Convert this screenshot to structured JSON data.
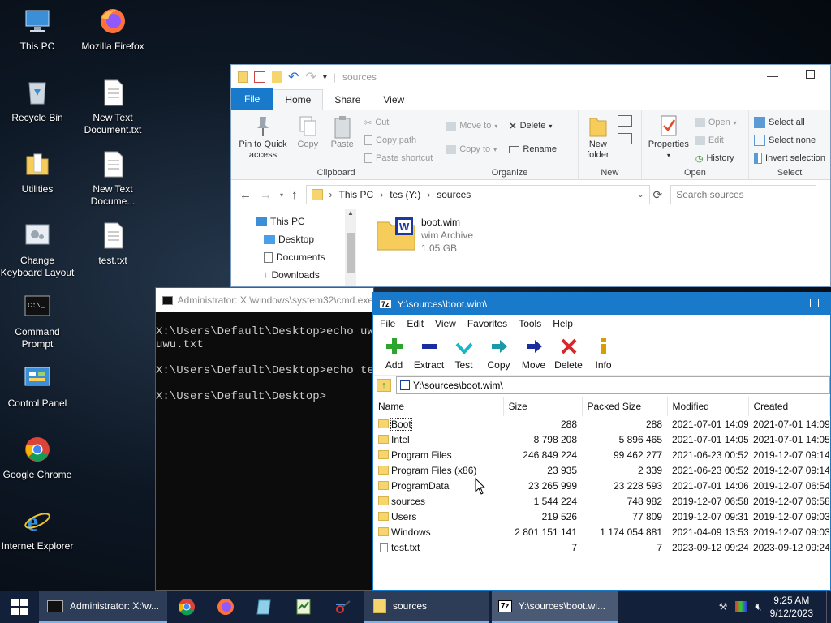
{
  "desktop": {
    "icons": [
      {
        "label": "This PC"
      },
      {
        "label": "Mozilla Firefox"
      },
      {
        "label": "Recycle Bin"
      },
      {
        "label": "New Text Document.txt"
      },
      {
        "label": "Utilities"
      },
      {
        "label": "New Text Docume..."
      },
      {
        "label": "Change Keyboard Layout"
      },
      {
        "label": "test.txt"
      },
      {
        "label": "Command Prompt"
      },
      {
        "label": "Control Panel"
      },
      {
        "label": "Google Chrome"
      },
      {
        "label": "Internet Explorer"
      }
    ]
  },
  "explorer": {
    "title": "sources",
    "tabs": {
      "file": "File",
      "home": "Home",
      "share": "Share",
      "view": "View"
    },
    "clipboard": {
      "pin": "Pin to Quick access",
      "copy": "Copy",
      "paste": "Paste",
      "cut": "Cut",
      "copy_path": "Copy path",
      "paste_shortcut": "Paste shortcut",
      "group": "Clipboard"
    },
    "organize": {
      "move_to": "Move to",
      "copy_to": "Copy to",
      "delete": "Delete",
      "rename": "Rename",
      "group": "Organize"
    },
    "new": {
      "new_folder": "New folder",
      "group": "New"
    },
    "open": {
      "properties": "Properties",
      "open": "Open",
      "edit": "Edit",
      "history": "History",
      "group": "Open"
    },
    "select": {
      "select_all": "Select all",
      "select_none": "Select none",
      "invert": "Invert selection",
      "group": "Select"
    },
    "address": {
      "this_pc": "This PC",
      "drive": "tes (Y:)",
      "folder": "sources"
    },
    "search_placeholder": "Search sources",
    "nav": {
      "this_pc": "This PC",
      "desktop": "Desktop",
      "documents": "Documents",
      "downloads": "Downloads"
    },
    "file": {
      "name": "boot.wim",
      "type": "wim Archive",
      "size": "1.05 GB"
    }
  },
  "cmd": {
    "title": "Administrator: X:\\windows\\system32\\cmd.exe",
    "lines": [
      "",
      "X:\\Users\\Default\\Desktop>echo uwu > test.txt",
      "uwu.txt",
      "",
      "X:\\Users\\Default\\Desktop>echo test",
      "",
      "X:\\Users\\Default\\Desktop>"
    ]
  },
  "zip": {
    "title": "Y:\\sources\\boot.wim\\",
    "menu": [
      "File",
      "Edit",
      "View",
      "Favorites",
      "Tools",
      "Help"
    ],
    "tools": {
      "add": "Add",
      "extract": "Extract",
      "test": "Test",
      "copy": "Copy",
      "move": "Move",
      "delete": "Delete",
      "info": "Info"
    },
    "path": "Y:\\sources\\boot.wim\\",
    "columns": {
      "name": "Name",
      "size": "Size",
      "packed": "Packed Size",
      "modified": "Modified",
      "created": "Created"
    },
    "rows": [
      {
        "name": "Boot",
        "size": "288",
        "packed": "288",
        "modified": "2021-07-01 14:09",
        "created": "2021-07-01 14:09",
        "type": "folder"
      },
      {
        "name": "Intel",
        "size": "8 798 208",
        "packed": "5 896 465",
        "modified": "2021-07-01 14:05",
        "created": "2021-07-01 14:05",
        "type": "folder"
      },
      {
        "name": "Program Files",
        "size": "246 849 224",
        "packed": "99 462 277",
        "modified": "2021-06-23 00:52",
        "created": "2019-12-07 09:14",
        "type": "folder"
      },
      {
        "name": "Program Files (x86)",
        "size": "23 935",
        "packed": "2 339",
        "modified": "2021-06-23 00:52",
        "created": "2019-12-07 09:14",
        "type": "folder"
      },
      {
        "name": "ProgramData",
        "size": "23 265 999",
        "packed": "23 228 593",
        "modified": "2021-07-01 14:06",
        "created": "2019-12-07 06:54",
        "type": "folder"
      },
      {
        "name": "sources",
        "size": "1 544 224",
        "packed": "748 982",
        "modified": "2019-12-07 06:58",
        "created": "2019-12-07 06:58",
        "type": "folder"
      },
      {
        "name": "Users",
        "size": "219 526",
        "packed": "77 809",
        "modified": "2019-12-07 09:31",
        "created": "2019-12-07 09:03",
        "type": "folder"
      },
      {
        "name": "Windows",
        "size": "2 801 151 141",
        "packed": "1 174 054 881",
        "modified": "2021-04-09 13:53",
        "created": "2019-12-07 09:03",
        "type": "folder"
      },
      {
        "name": "test.txt",
        "size": "7",
        "packed": "7",
        "modified": "2023-09-12 09:24",
        "created": "2023-09-12 09:24",
        "type": "file"
      }
    ]
  },
  "taskbar": {
    "cmd_label": "Administrator: X:\\w...",
    "explorer_label": "sources",
    "zip_label": "Y:\\sources\\boot.wi...",
    "time": "9:25 AM",
    "date": "9/12/2023"
  },
  "colors": {
    "accent": "#1979ca",
    "taskbar": "#12203a",
    "console_bg": "#0c0c0c"
  }
}
